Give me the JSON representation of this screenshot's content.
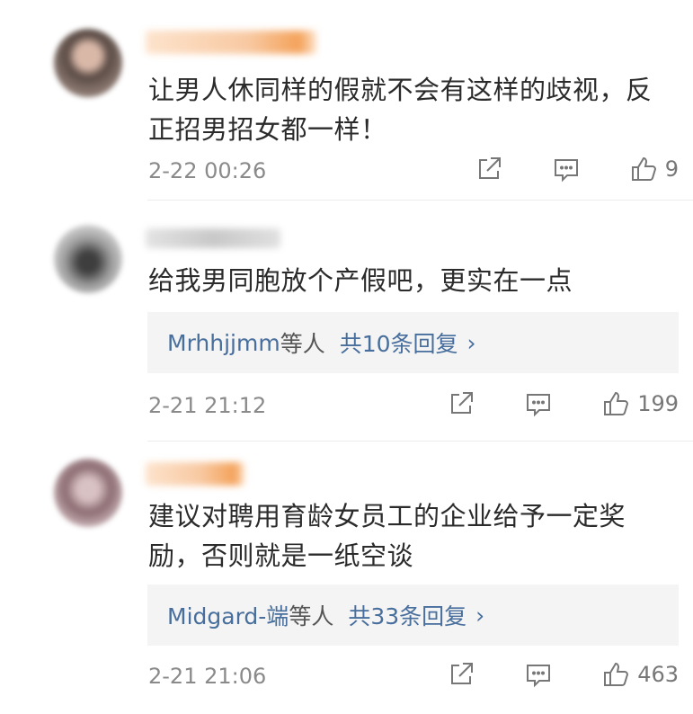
{
  "comments": [
    {
      "text_line1": "让男人休同样的假就不会有这样的歧视，反",
      "text_line2": "正招男招女都一样！",
      "time": "2-22 00:26",
      "likes": "9",
      "avatar_color": "#7b6a62",
      "username_color": "#f7c49a"
    },
    {
      "text_line1": "给我男同胞放个产假吧，更实在一点",
      "reply_names": "Mrhhjjmm",
      "reply_suffix": "等人",
      "reply_count": "共10条回复",
      "time": "2-21 21:12",
      "likes": "199",
      "avatar_color": "#8f8f8f",
      "username_color": "#d8d8d8"
    },
    {
      "text_line1": "建议对聘用育龄女员工的企业给予一定奖",
      "text_line2": "励，否则就是一纸空谈",
      "reply_names": "Midgard-端",
      "reply_suffix": "等人",
      "reply_count": "共33条回复",
      "time": "2-21 21:06",
      "likes": "463",
      "avatar_color": "#9a7f83",
      "username_color": "#f7c49a"
    }
  ],
  "icons": {
    "share": "share-icon",
    "comment": "comment-icon",
    "like": "thumbs-up-icon",
    "chevron": "chevron-right-icon"
  },
  "colors": {
    "link": "#476e9c",
    "meta": "#8a8a8a",
    "reply_bg": "#f4f4f4"
  }
}
